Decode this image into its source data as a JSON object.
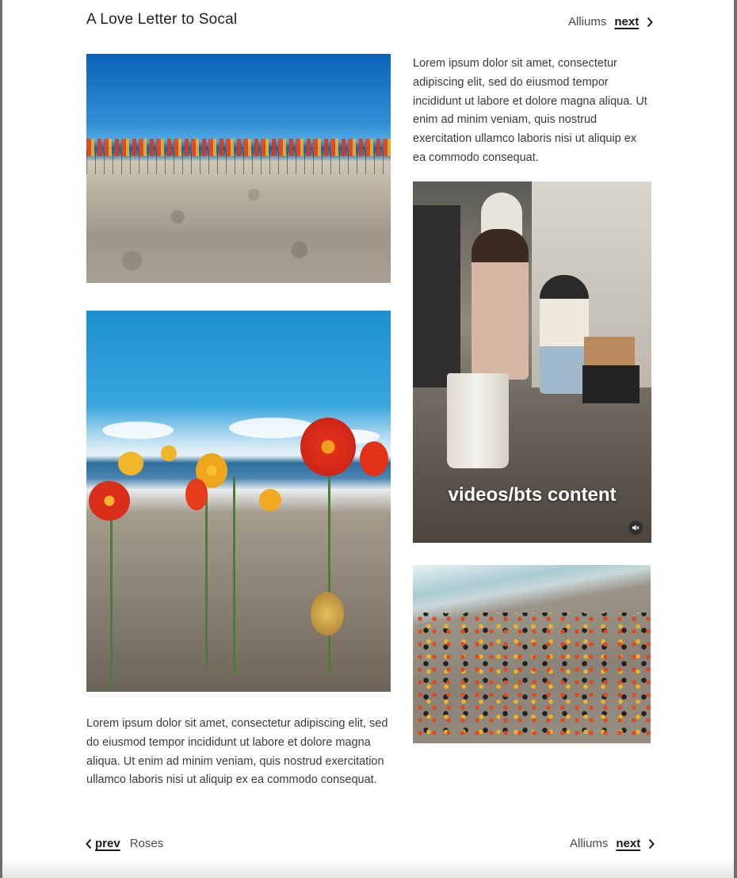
{
  "header": {
    "title": "A Love Letter to Socal"
  },
  "nav_top": {
    "label": "Alliums",
    "next": "next"
  },
  "text_blocks": {
    "top": "Lorem ipsum dolor sit amet, consectetur adipiscing elit, sed do eiusmod tempor incididunt ut labore et dolore magna aliqua. Ut enim ad minim veniam, quis nostrud exercitation ullamco laboris nisi ut aliquip ex ea commodo consequat.",
    "bottom": "Lorem ipsum dolor sit amet, consectetur adipiscing elit, sed do eiusmod tempor incididunt ut labore et dolore magna aliqua. Ut enim ad minim veniam, quis nostrud exercitation ullamco laboris nisi ut aliquip ex ea commodo consequat."
  },
  "video": {
    "caption": "videos/bts content",
    "mute_icon": "muted-speaker-icon"
  },
  "nav_bottom": {
    "prev": "prev",
    "prev_label": "Roses",
    "next_label": "Alliums",
    "next": "next"
  },
  "icons": {
    "next": "chevron-right-icon",
    "prev": "chevron-left-icon"
  }
}
